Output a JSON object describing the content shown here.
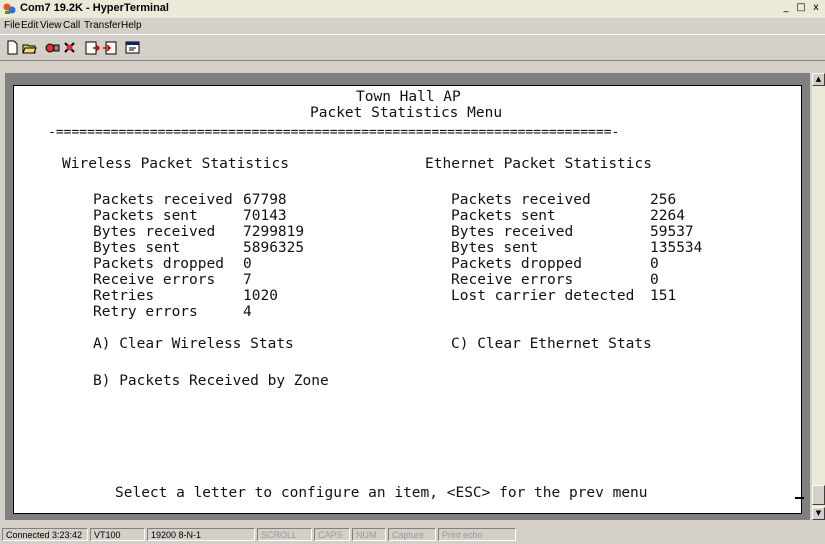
{
  "window": {
    "title": "Com7 19.2K - HyperTerminal",
    "minimize": "_",
    "maximize": "□",
    "close": "x"
  },
  "menu": {
    "items": [
      {
        "label": "File"
      },
      {
        "label": "Edit"
      },
      {
        "label": "View"
      },
      {
        "label": "Call"
      },
      {
        "label": "Transfer"
      },
      {
        "label": "Help"
      }
    ]
  },
  "toolbar": {
    "buttons": [
      "new-icon",
      "open-icon",
      "connect-icon",
      "disconnect-icon",
      "send-icon",
      "receive-icon",
      "properties-icon"
    ]
  },
  "terminal": {
    "header_line1": "Town Hall AP",
    "header_line2": "Packet Statistics Menu",
    "separator": "-=======================================================================-",
    "wireless": {
      "heading": "Wireless Packet Statistics",
      "rows": [
        {
          "label": "Packets received",
          "value": "67798"
        },
        {
          "label": "Packets sent",
          "value": "70143"
        },
        {
          "label": "Bytes received",
          "value": "7299819"
        },
        {
          "label": "Bytes sent",
          "value": "5896325"
        },
        {
          "label": "Packets dropped",
          "value": "0"
        },
        {
          "label": "Receive errors",
          "value": "7"
        },
        {
          "label": "Retries",
          "value": "1020"
        },
        {
          "label": "Retry errors",
          "value": "4"
        }
      ]
    },
    "ethernet": {
      "heading": "Ethernet Packet Statistics",
      "rows": [
        {
          "label": "Packets received",
          "value": "256"
        },
        {
          "label": "Packets sent",
          "value": "2264"
        },
        {
          "label": "Bytes received",
          "value": "59537"
        },
        {
          "label": "Bytes sent",
          "value": "135534"
        },
        {
          "label": "Packets dropped",
          "value": "0"
        },
        {
          "label": "Receive errors",
          "value": "0"
        },
        {
          "label": "Lost carrier detected",
          "value": "151"
        }
      ]
    },
    "option_a": "A) Clear Wireless Stats",
    "option_c": "C) Clear Ethernet Stats",
    "option_b": "B) Packets Received by Zone",
    "prompt": "Select a letter to configure an item, <ESC> for the prev menu"
  },
  "statusbar": {
    "connected": "Connected 3:23:42",
    "emulation": "VT100",
    "settings": "19200 8-N-1",
    "scroll": "SCROLL",
    "caps": "CAPS",
    "num": "NUM",
    "capture": "Capture",
    "print_echo": "Print echo"
  },
  "colors": {
    "window_bg": "#d4d0c8",
    "terminal_bg": "#ffffff",
    "terminal_text": "#111111"
  }
}
